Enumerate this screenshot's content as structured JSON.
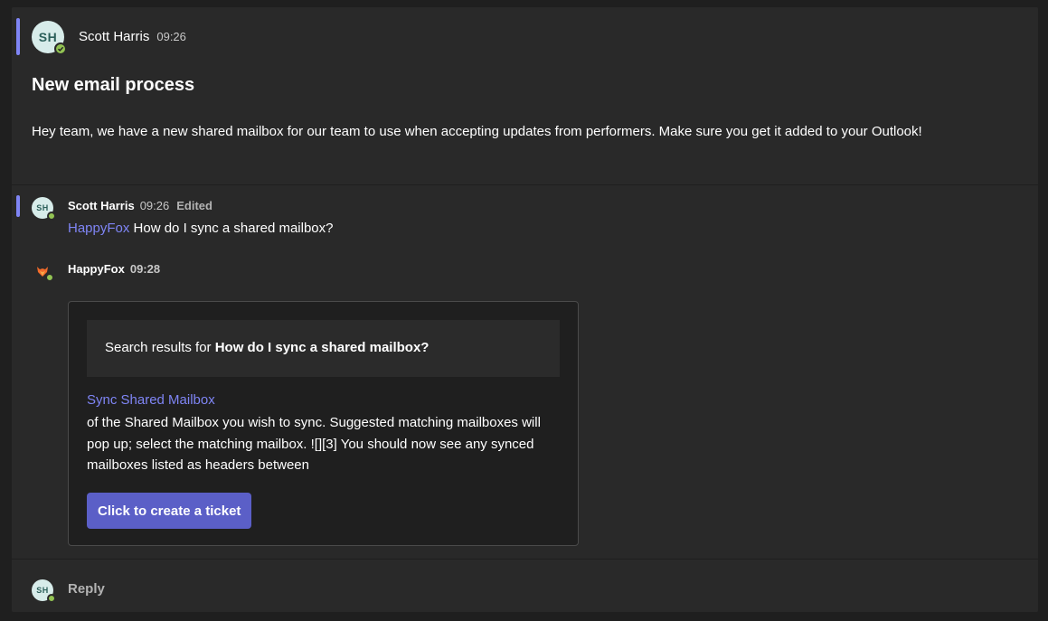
{
  "root_post": {
    "avatar_initials": "SH",
    "author": "Scott Harris",
    "time": "09:26",
    "title": "New email process",
    "body": "Hey team, we have a new shared mailbox for our team to use when accepting updates from performers.  Make sure you get it added to your Outlook!"
  },
  "replies": [
    {
      "avatar_initials": "SH",
      "author": "Scott Harris",
      "time": "09:26",
      "edited_label": "Edited",
      "mention": "HappyFox",
      "text": " How do I sync a shared mailbox?"
    },
    {
      "avatar_icon": "fox-icon",
      "author": "HappyFox",
      "time": "09:28",
      "card": {
        "header_prefix": "Search results for ",
        "header_query": "How do I sync a shared mailbox?",
        "result_title": "Sync Shared Mailbox",
        "result_snippet": "of the Shared Mailbox you wish to sync. Suggested matching mailboxes will pop up; select the matching mailbox. ![][3] You should now see any synced mailboxes listed as headers between",
        "button_label": "Click to create a ticket"
      }
    }
  ],
  "reply_bar": {
    "avatar_initials": "SH",
    "label": "Reply"
  },
  "colors": {
    "accent": "#7f85f5",
    "button": "#5b5fc7",
    "presence": "#92c353",
    "background": "#1f1f1f",
    "surface": "#292929"
  }
}
